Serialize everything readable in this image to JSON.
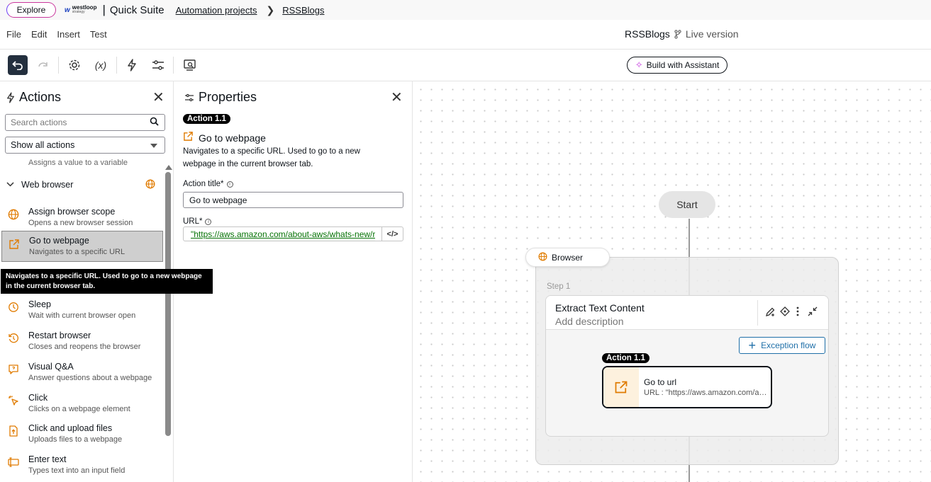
{
  "topbar": {
    "explore_label": "Explore",
    "logo_line1": "westloop",
    "logo_line2": "strategy",
    "suite_name": "Quick Suite",
    "breadcrumb": [
      "Automation projects",
      "RSSBlogs"
    ]
  },
  "menu": {
    "items": [
      "File",
      "Edit",
      "Insert",
      "Test"
    ],
    "project_name": "RSSBlogs",
    "version_label": "Live version"
  },
  "toolbar": {
    "variables_label": "(x)",
    "assistant_label": "Build with Assistant"
  },
  "actions_panel": {
    "title": "Actions",
    "search_placeholder": "Search actions",
    "filter_value": "Show all actions",
    "partial_desc": "Assigns a value to a variable",
    "group_label": "Web browser",
    "items": [
      {
        "title": "Assign browser scope",
        "desc": "Opens a new browser session",
        "icon": "globe-icon"
      },
      {
        "title": "Go to webpage",
        "desc": "Navigates to a specific URL",
        "icon": "external-link-icon"
      },
      {
        "title": "Sleep",
        "desc": "Wait with current browser open",
        "icon": "clock-icon"
      },
      {
        "title": "Restart browser",
        "desc": "Closes and reopens the browser",
        "icon": "restart-icon"
      },
      {
        "title": "Visual Q&A",
        "desc": "Answer questions about a webpage",
        "icon": "chat-icon"
      },
      {
        "title": "Click",
        "desc": "Clicks on a webpage element",
        "icon": "cursor-click-icon"
      },
      {
        "title": "Click and upload files",
        "desc": "Uploads files to a webpage",
        "icon": "file-upload-icon"
      },
      {
        "title": "Enter text",
        "desc": "Types text into an input field",
        "icon": "text-input-icon"
      }
    ],
    "tooltip": "Navigates to a specific URL. Used to go to a new webpage in the current browser tab."
  },
  "properties_panel": {
    "title": "Properties",
    "badge": "Action 1.1",
    "action_name": "Go to webpage",
    "description": "Navigates to a specific URL. Used to go to a new webpage in the current browser tab.",
    "title_field_label": "Action title*",
    "title_field_value": "Go to webpage",
    "url_field_label": "URL*",
    "url_field_value": "\"https://aws.amazon.com/about-aws/whats-new/recent/feed/\"",
    "code_button_label": "</>"
  },
  "canvas": {
    "start_label": "Start",
    "browser_label": "Browser",
    "step_label": "Step 1",
    "step_title": "Extract Text Content",
    "step_description": "Add description",
    "exception_label": "Exception flow",
    "action_badge": "Action 1.1",
    "action_title": "Go to url",
    "action_desc": "URL : \"https://aws.amazon.com/about-aws/whats-new/recent/feed/\""
  },
  "colors": {
    "accent_orange": "#e07b00",
    "link_blue": "#1f6fa8",
    "dark": "#0f141a"
  }
}
